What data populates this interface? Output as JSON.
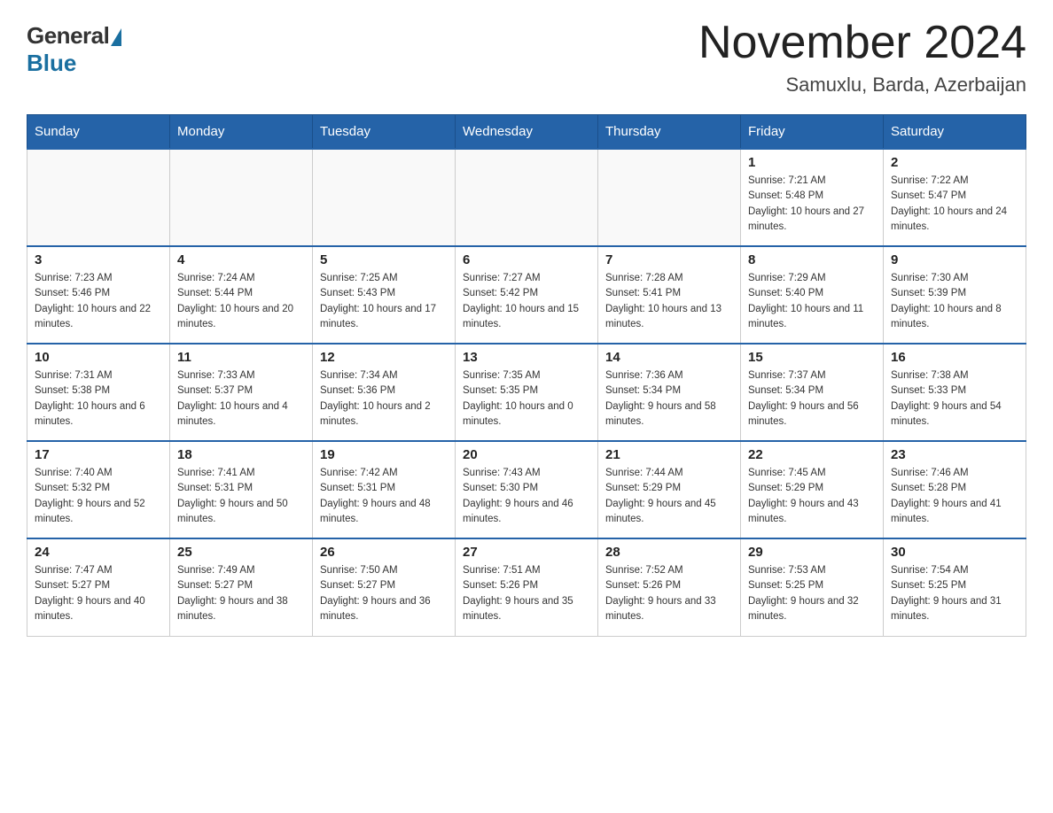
{
  "header": {
    "logo_general": "General",
    "logo_blue": "Blue",
    "title": "November 2024",
    "subtitle": "Samuxlu, Barda, Azerbaijan"
  },
  "weekdays": [
    "Sunday",
    "Monday",
    "Tuesday",
    "Wednesday",
    "Thursday",
    "Friday",
    "Saturday"
  ],
  "weeks": [
    [
      {
        "day": "",
        "sunrise": "",
        "sunset": "",
        "daylight": ""
      },
      {
        "day": "",
        "sunrise": "",
        "sunset": "",
        "daylight": ""
      },
      {
        "day": "",
        "sunrise": "",
        "sunset": "",
        "daylight": ""
      },
      {
        "day": "",
        "sunrise": "",
        "sunset": "",
        "daylight": ""
      },
      {
        "day": "",
        "sunrise": "",
        "sunset": "",
        "daylight": ""
      },
      {
        "day": "1",
        "sunrise": "Sunrise: 7:21 AM",
        "sunset": "Sunset: 5:48 PM",
        "daylight": "Daylight: 10 hours and 27 minutes."
      },
      {
        "day": "2",
        "sunrise": "Sunrise: 7:22 AM",
        "sunset": "Sunset: 5:47 PM",
        "daylight": "Daylight: 10 hours and 24 minutes."
      }
    ],
    [
      {
        "day": "3",
        "sunrise": "Sunrise: 7:23 AM",
        "sunset": "Sunset: 5:46 PM",
        "daylight": "Daylight: 10 hours and 22 minutes."
      },
      {
        "day": "4",
        "sunrise": "Sunrise: 7:24 AM",
        "sunset": "Sunset: 5:44 PM",
        "daylight": "Daylight: 10 hours and 20 minutes."
      },
      {
        "day": "5",
        "sunrise": "Sunrise: 7:25 AM",
        "sunset": "Sunset: 5:43 PM",
        "daylight": "Daylight: 10 hours and 17 minutes."
      },
      {
        "day": "6",
        "sunrise": "Sunrise: 7:27 AM",
        "sunset": "Sunset: 5:42 PM",
        "daylight": "Daylight: 10 hours and 15 minutes."
      },
      {
        "day": "7",
        "sunrise": "Sunrise: 7:28 AM",
        "sunset": "Sunset: 5:41 PM",
        "daylight": "Daylight: 10 hours and 13 minutes."
      },
      {
        "day": "8",
        "sunrise": "Sunrise: 7:29 AM",
        "sunset": "Sunset: 5:40 PM",
        "daylight": "Daylight: 10 hours and 11 minutes."
      },
      {
        "day": "9",
        "sunrise": "Sunrise: 7:30 AM",
        "sunset": "Sunset: 5:39 PM",
        "daylight": "Daylight: 10 hours and 8 minutes."
      }
    ],
    [
      {
        "day": "10",
        "sunrise": "Sunrise: 7:31 AM",
        "sunset": "Sunset: 5:38 PM",
        "daylight": "Daylight: 10 hours and 6 minutes."
      },
      {
        "day": "11",
        "sunrise": "Sunrise: 7:33 AM",
        "sunset": "Sunset: 5:37 PM",
        "daylight": "Daylight: 10 hours and 4 minutes."
      },
      {
        "day": "12",
        "sunrise": "Sunrise: 7:34 AM",
        "sunset": "Sunset: 5:36 PM",
        "daylight": "Daylight: 10 hours and 2 minutes."
      },
      {
        "day": "13",
        "sunrise": "Sunrise: 7:35 AM",
        "sunset": "Sunset: 5:35 PM",
        "daylight": "Daylight: 10 hours and 0 minutes."
      },
      {
        "day": "14",
        "sunrise": "Sunrise: 7:36 AM",
        "sunset": "Sunset: 5:34 PM",
        "daylight": "Daylight: 9 hours and 58 minutes."
      },
      {
        "day": "15",
        "sunrise": "Sunrise: 7:37 AM",
        "sunset": "Sunset: 5:34 PM",
        "daylight": "Daylight: 9 hours and 56 minutes."
      },
      {
        "day": "16",
        "sunrise": "Sunrise: 7:38 AM",
        "sunset": "Sunset: 5:33 PM",
        "daylight": "Daylight: 9 hours and 54 minutes."
      }
    ],
    [
      {
        "day": "17",
        "sunrise": "Sunrise: 7:40 AM",
        "sunset": "Sunset: 5:32 PM",
        "daylight": "Daylight: 9 hours and 52 minutes."
      },
      {
        "day": "18",
        "sunrise": "Sunrise: 7:41 AM",
        "sunset": "Sunset: 5:31 PM",
        "daylight": "Daylight: 9 hours and 50 minutes."
      },
      {
        "day": "19",
        "sunrise": "Sunrise: 7:42 AM",
        "sunset": "Sunset: 5:31 PM",
        "daylight": "Daylight: 9 hours and 48 minutes."
      },
      {
        "day": "20",
        "sunrise": "Sunrise: 7:43 AM",
        "sunset": "Sunset: 5:30 PM",
        "daylight": "Daylight: 9 hours and 46 minutes."
      },
      {
        "day": "21",
        "sunrise": "Sunrise: 7:44 AM",
        "sunset": "Sunset: 5:29 PM",
        "daylight": "Daylight: 9 hours and 45 minutes."
      },
      {
        "day": "22",
        "sunrise": "Sunrise: 7:45 AM",
        "sunset": "Sunset: 5:29 PM",
        "daylight": "Daylight: 9 hours and 43 minutes."
      },
      {
        "day": "23",
        "sunrise": "Sunrise: 7:46 AM",
        "sunset": "Sunset: 5:28 PM",
        "daylight": "Daylight: 9 hours and 41 minutes."
      }
    ],
    [
      {
        "day": "24",
        "sunrise": "Sunrise: 7:47 AM",
        "sunset": "Sunset: 5:27 PM",
        "daylight": "Daylight: 9 hours and 40 minutes."
      },
      {
        "day": "25",
        "sunrise": "Sunrise: 7:49 AM",
        "sunset": "Sunset: 5:27 PM",
        "daylight": "Daylight: 9 hours and 38 minutes."
      },
      {
        "day": "26",
        "sunrise": "Sunrise: 7:50 AM",
        "sunset": "Sunset: 5:27 PM",
        "daylight": "Daylight: 9 hours and 36 minutes."
      },
      {
        "day": "27",
        "sunrise": "Sunrise: 7:51 AM",
        "sunset": "Sunset: 5:26 PM",
        "daylight": "Daylight: 9 hours and 35 minutes."
      },
      {
        "day": "28",
        "sunrise": "Sunrise: 7:52 AM",
        "sunset": "Sunset: 5:26 PM",
        "daylight": "Daylight: 9 hours and 33 minutes."
      },
      {
        "day": "29",
        "sunrise": "Sunrise: 7:53 AM",
        "sunset": "Sunset: 5:25 PM",
        "daylight": "Daylight: 9 hours and 32 minutes."
      },
      {
        "day": "30",
        "sunrise": "Sunrise: 7:54 AM",
        "sunset": "Sunset: 5:25 PM",
        "daylight": "Daylight: 9 hours and 31 minutes."
      }
    ]
  ]
}
